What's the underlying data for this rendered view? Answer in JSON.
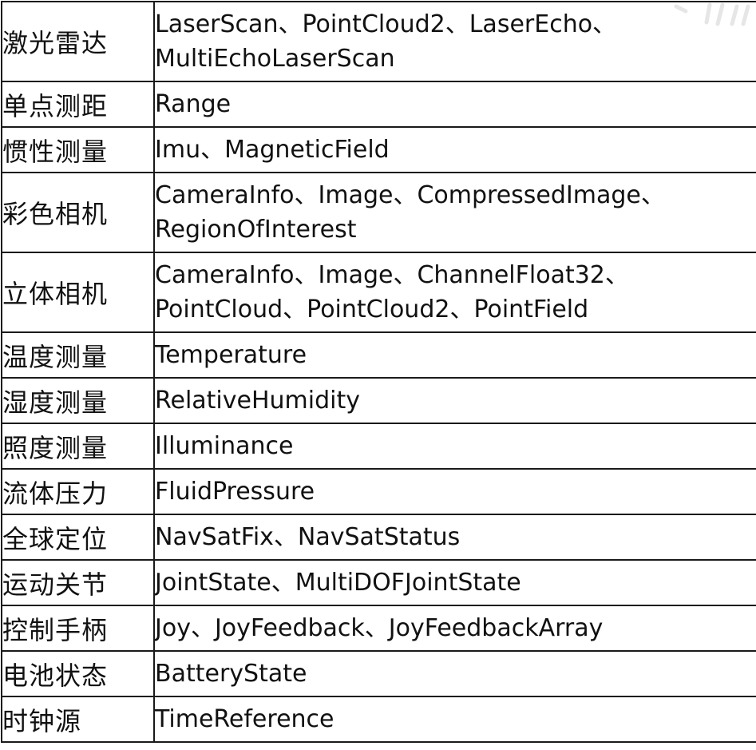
{
  "rows": [
    {
      "sensor": "激光雷达",
      "messages": "LaserScan、PointCloud2、LaserEcho、MultiEchoLaserScan"
    },
    {
      "sensor": "单点测距",
      "messages": "Range"
    },
    {
      "sensor": "惯性测量",
      "messages": "Imu、MagneticField"
    },
    {
      "sensor": "彩色相机",
      "messages": "CameraInfo、Image、CompressedImage、RegionOfInterest"
    },
    {
      "sensor": "立体相机",
      "messages": "CameraInfo、Image、ChannelFloat32、PointCloud、PointCloud2、PointField"
    },
    {
      "sensor": "温度测量",
      "messages": "Temperature"
    },
    {
      "sensor": "湿度测量",
      "messages": "RelativeHumidity"
    },
    {
      "sensor": "照度测量",
      "messages": "Illuminance"
    },
    {
      "sensor": "流体压力",
      "messages": "FluidPressure"
    },
    {
      "sensor": "全球定位",
      "messages": "NavSatFix、NavSatStatus"
    },
    {
      "sensor": "运动关节",
      "messages": "JointState、MultiDOFJointState"
    },
    {
      "sensor": "控制手柄",
      "messages": "Joy、JoyFeedback、JoyFeedbackArray"
    },
    {
      "sensor": "电池状态",
      "messages": "BatteryState"
    },
    {
      "sensor": "时钟源",
      "messages": "TimeReference"
    }
  ]
}
